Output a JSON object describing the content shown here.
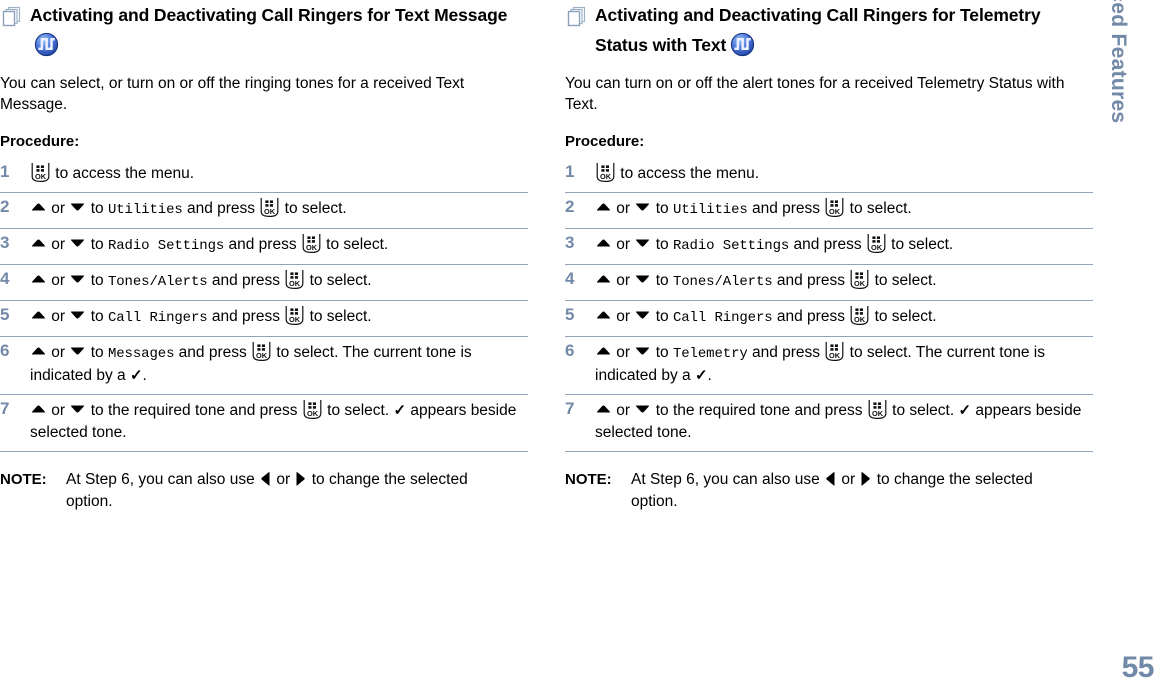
{
  "page": {
    "number": "55",
    "sidebar_tab_label": "Advanced Features",
    "colors": {
      "accent_blue_gray": "#7389A8",
      "rule_line": "#8FA3BC",
      "tone_icon_blue": "#3B5FC0",
      "text": "#000000"
    }
  },
  "columns": [
    {
      "heading": {
        "icon": "stacked-pages-icon",
        "text": "Activating and Deactivating Call Ringers for Text Message",
        "trailing_icon": "tone-square-wave-icon"
      },
      "intro": "You can select, or turn on or off the ringing tones for a received Text Message.",
      "procedure_label": "Procedure:",
      "steps": [
        {
          "number": "1",
          "parts": [
            {
              "type": "okkey"
            },
            {
              "type": "text",
              "value": " to access the menu."
            }
          ]
        },
        {
          "number": "2",
          "parts": [
            {
              "type": "arrow-up"
            },
            {
              "type": "text",
              "value": " or "
            },
            {
              "type": "arrow-down"
            },
            {
              "type": "text",
              "value": " to "
            },
            {
              "type": "mono",
              "value": "Utilities"
            },
            {
              "type": "text",
              "value": " and press "
            },
            {
              "type": "okkey"
            },
            {
              "type": "text",
              "value": " to select."
            }
          ]
        },
        {
          "number": "3",
          "parts": [
            {
              "type": "arrow-up"
            },
            {
              "type": "text",
              "value": " or "
            },
            {
              "type": "arrow-down"
            },
            {
              "type": "text",
              "value": " to "
            },
            {
              "type": "mono",
              "value": "Radio Settings"
            },
            {
              "type": "text",
              "value": " and press "
            },
            {
              "type": "okkey"
            },
            {
              "type": "text",
              "value": " to select."
            }
          ]
        },
        {
          "number": "4",
          "parts": [
            {
              "type": "arrow-up"
            },
            {
              "type": "text",
              "value": " or "
            },
            {
              "type": "arrow-down"
            },
            {
              "type": "text",
              "value": " to "
            },
            {
              "type": "mono",
              "value": "Tones/Alerts"
            },
            {
              "type": "text",
              "value": " and press "
            },
            {
              "type": "okkey"
            },
            {
              "type": "text",
              "value": " to select."
            }
          ]
        },
        {
          "number": "5",
          "parts": [
            {
              "type": "arrow-up"
            },
            {
              "type": "text",
              "value": " or "
            },
            {
              "type": "arrow-down"
            },
            {
              "type": "text",
              "value": " to "
            },
            {
              "type": "mono",
              "value": "Call Ringers"
            },
            {
              "type": "text",
              "value": " and press "
            },
            {
              "type": "okkey"
            },
            {
              "type": "text",
              "value": " to select."
            }
          ]
        },
        {
          "number": "6",
          "parts": [
            {
              "type": "arrow-up"
            },
            {
              "type": "text",
              "value": " or "
            },
            {
              "type": "arrow-down"
            },
            {
              "type": "text",
              "value": " to "
            },
            {
              "type": "mono",
              "value": "Messages"
            },
            {
              "type": "text",
              "value": " and press "
            },
            {
              "type": "okkey"
            },
            {
              "type": "text",
              "value": " to select. The current tone is indicated by a "
            },
            {
              "type": "check"
            },
            {
              "type": "text",
              "value": "."
            }
          ]
        },
        {
          "number": "7",
          "parts": [
            {
              "type": "text",
              "value": " "
            },
            {
              "type": "arrow-up"
            },
            {
              "type": "text",
              "value": " or "
            },
            {
              "type": "arrow-down"
            },
            {
              "type": "text",
              "value": " to the required tone and press "
            },
            {
              "type": "okkey"
            },
            {
              "type": "text",
              "value": " to select. "
            },
            {
              "type": "check"
            },
            {
              "type": "text",
              "value": " appears beside selected tone."
            }
          ]
        }
      ],
      "note": {
        "label": "NOTE:",
        "parts": [
          {
            "type": "text",
            "value": "At Step 6, you can also use "
          },
          {
            "type": "arrow-left"
          },
          {
            "type": "text",
            "value": " or "
          },
          {
            "type": "arrow-right"
          },
          {
            "type": "text",
            "value": " to change the selected option."
          }
        ]
      }
    },
    {
      "heading": {
        "icon": "stacked-pages-icon",
        "text": "Activating and Deactivating Call Ringers for Telemetry Status with Text",
        "trailing_icon": "tone-square-wave-icon"
      },
      "intro": "You can turn on or off the alert tones for a received Telemetry Status with Text.",
      "procedure_label": "Procedure:",
      "steps": [
        {
          "number": "1",
          "parts": [
            {
              "type": "okkey"
            },
            {
              "type": "text",
              "value": " to access the menu."
            }
          ]
        },
        {
          "number": "2",
          "parts": [
            {
              "type": "arrow-up"
            },
            {
              "type": "text",
              "value": " or "
            },
            {
              "type": "arrow-down"
            },
            {
              "type": "text",
              "value": " to "
            },
            {
              "type": "mono",
              "value": "Utilities"
            },
            {
              "type": "text",
              "value": " and press "
            },
            {
              "type": "okkey"
            },
            {
              "type": "text",
              "value": " to select."
            }
          ]
        },
        {
          "number": "3",
          "parts": [
            {
              "type": "arrow-up"
            },
            {
              "type": "text",
              "value": " or "
            },
            {
              "type": "arrow-down"
            },
            {
              "type": "text",
              "value": " to "
            },
            {
              "type": "mono",
              "value": "Radio Settings"
            },
            {
              "type": "text",
              "value": " and press "
            },
            {
              "type": "okkey"
            },
            {
              "type": "text",
              "value": " to select."
            }
          ]
        },
        {
          "number": "4",
          "parts": [
            {
              "type": "arrow-up"
            },
            {
              "type": "text",
              "value": " or "
            },
            {
              "type": "arrow-down"
            },
            {
              "type": "text",
              "value": " to "
            },
            {
              "type": "mono",
              "value": "Tones/Alerts"
            },
            {
              "type": "text",
              "value": " and press "
            },
            {
              "type": "okkey"
            },
            {
              "type": "text",
              "value": " to select."
            }
          ]
        },
        {
          "number": "5",
          "parts": [
            {
              "type": "arrow-up"
            },
            {
              "type": "text",
              "value": " or "
            },
            {
              "type": "arrow-down"
            },
            {
              "type": "text",
              "value": " to "
            },
            {
              "type": "mono",
              "value": "Call Ringers"
            },
            {
              "type": "text",
              "value": " and press "
            },
            {
              "type": "okkey"
            },
            {
              "type": "text",
              "value": " to select."
            }
          ]
        },
        {
          "number": "6",
          "parts": [
            {
              "type": "arrow-up"
            },
            {
              "type": "text",
              "value": " or "
            },
            {
              "type": "arrow-down"
            },
            {
              "type": "text",
              "value": " to "
            },
            {
              "type": "mono",
              "value": "Telemetry"
            },
            {
              "type": "text",
              "value": " and press "
            },
            {
              "type": "okkey"
            },
            {
              "type": "text",
              "value": " to select. The current tone is indicated by a "
            },
            {
              "type": "check"
            },
            {
              "type": "text",
              "value": "."
            }
          ]
        },
        {
          "number": "7",
          "parts": [
            {
              "type": "arrow-up"
            },
            {
              "type": "text",
              "value": " or "
            },
            {
              "type": "arrow-down"
            },
            {
              "type": "text",
              "value": " to the required tone and press "
            },
            {
              "type": "okkey"
            },
            {
              "type": "text",
              "value": " to select. "
            },
            {
              "type": "check"
            },
            {
              "type": "text",
              "value": " appears beside selected tone."
            }
          ]
        }
      ],
      "note": {
        "label": "NOTE:",
        "parts": [
          {
            "type": "text",
            "value": "At Step 6, you can also use "
          },
          {
            "type": "arrow-left"
          },
          {
            "type": "text",
            "value": " or "
          },
          {
            "type": "arrow-right"
          },
          {
            "type": "text",
            "value": " to change the selected option."
          }
        ]
      }
    }
  ]
}
